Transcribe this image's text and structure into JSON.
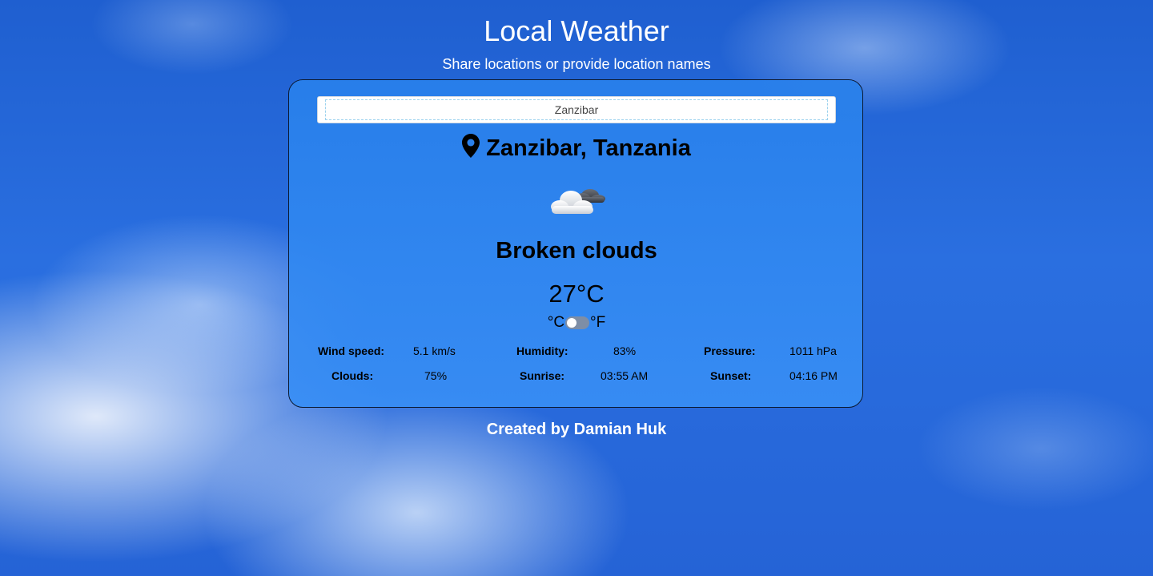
{
  "header": {
    "title": "Local Weather",
    "subtitle": "Share locations or provide location names"
  },
  "search": {
    "value": "Zanzibar"
  },
  "location": {
    "icon": "map-pin-icon",
    "name": "Zanzibar, Tanzania"
  },
  "weather": {
    "icon": "broken-clouds-icon",
    "condition": "Broken clouds",
    "temperature": "27°C"
  },
  "unit_toggle": {
    "left_label": "°C",
    "right_label": "°F",
    "selected": "°C"
  },
  "stats": {
    "wind_speed": {
      "label": "Wind speed:",
      "value": "5.1 km/s"
    },
    "humidity": {
      "label": "Humidity:",
      "value": "83%"
    },
    "pressure": {
      "label": "Pressure:",
      "value": "1011 hPa"
    },
    "clouds": {
      "label": "Clouds:",
      "value": "75%"
    },
    "sunrise": {
      "label": "Sunrise:",
      "value": "03:55 AM"
    },
    "sunset": {
      "label": "Sunset:",
      "value": "04:16 PM"
    }
  },
  "footer": {
    "credit": "Created by Damian Huk"
  },
  "colors": {
    "card_background": "#2b83ea",
    "card_border": "#0b1a33",
    "text": "#000000",
    "header_text": "#ffffff"
  }
}
